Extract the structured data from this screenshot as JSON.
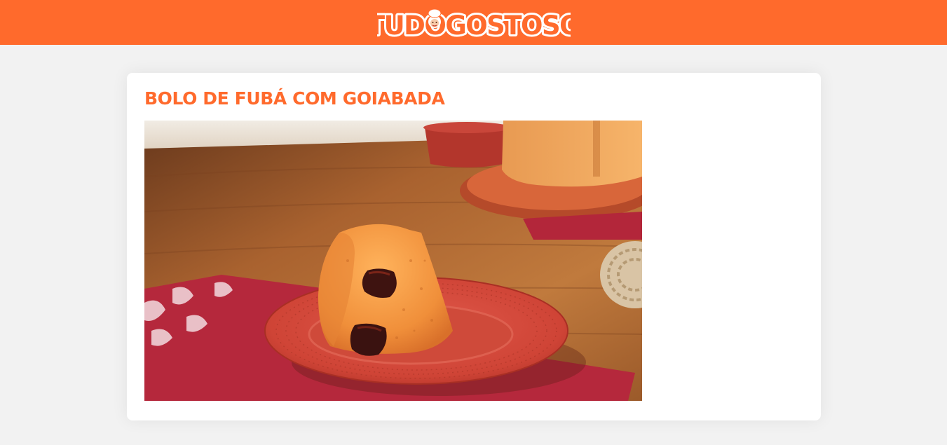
{
  "header": {
    "logo_text": "TUDOGOSTOSO",
    "logo_icon": "chef-hat-mascot-icon",
    "background_color": "#ff6a2c"
  },
  "recipe": {
    "title": "BOLO DE FUBÁ COM GOIABADA",
    "title_color": "#ff6a2c",
    "image_icon": "cake-photo"
  },
  "page": {
    "background_color": "#f2f2f2"
  }
}
